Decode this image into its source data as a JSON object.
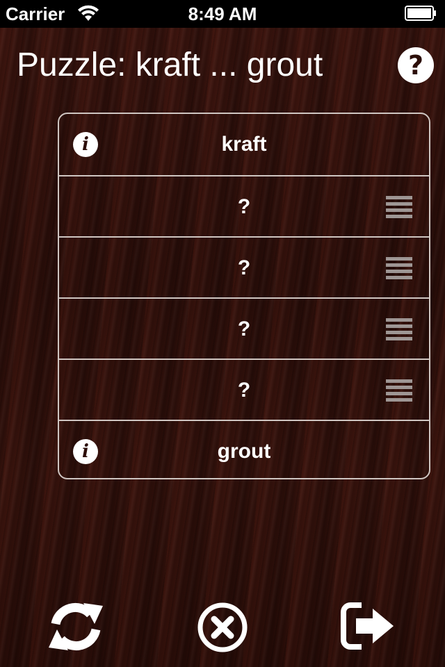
{
  "status_bar": {
    "carrier": "Carrier",
    "time": "8:49 AM"
  },
  "header": {
    "title": "Puzzle: kraft ... grout",
    "help_icon": "question-circle-icon",
    "help_glyph": "?"
  },
  "puzzle": {
    "rows": [
      {
        "label": "kraft",
        "icon": "info-icon",
        "icon_glyph": "i"
      },
      {
        "label": "?",
        "icon": "drag-handle-icon"
      },
      {
        "label": "?",
        "icon": "drag-handle-icon"
      },
      {
        "label": "?",
        "icon": "drag-handle-icon"
      },
      {
        "label": "?",
        "icon": "drag-handle-icon"
      },
      {
        "label": "grout",
        "icon": "info-icon",
        "icon_glyph": "i"
      }
    ]
  },
  "toolbar": {
    "refresh_icon": "refresh-icon",
    "clear_icon": "close-circle-icon",
    "exit_icon": "exit-icon"
  },
  "colors": {
    "wood": "#3a140e",
    "text": "#ffffff",
    "border": "#cfc6c2",
    "grip": "#9e9694"
  }
}
